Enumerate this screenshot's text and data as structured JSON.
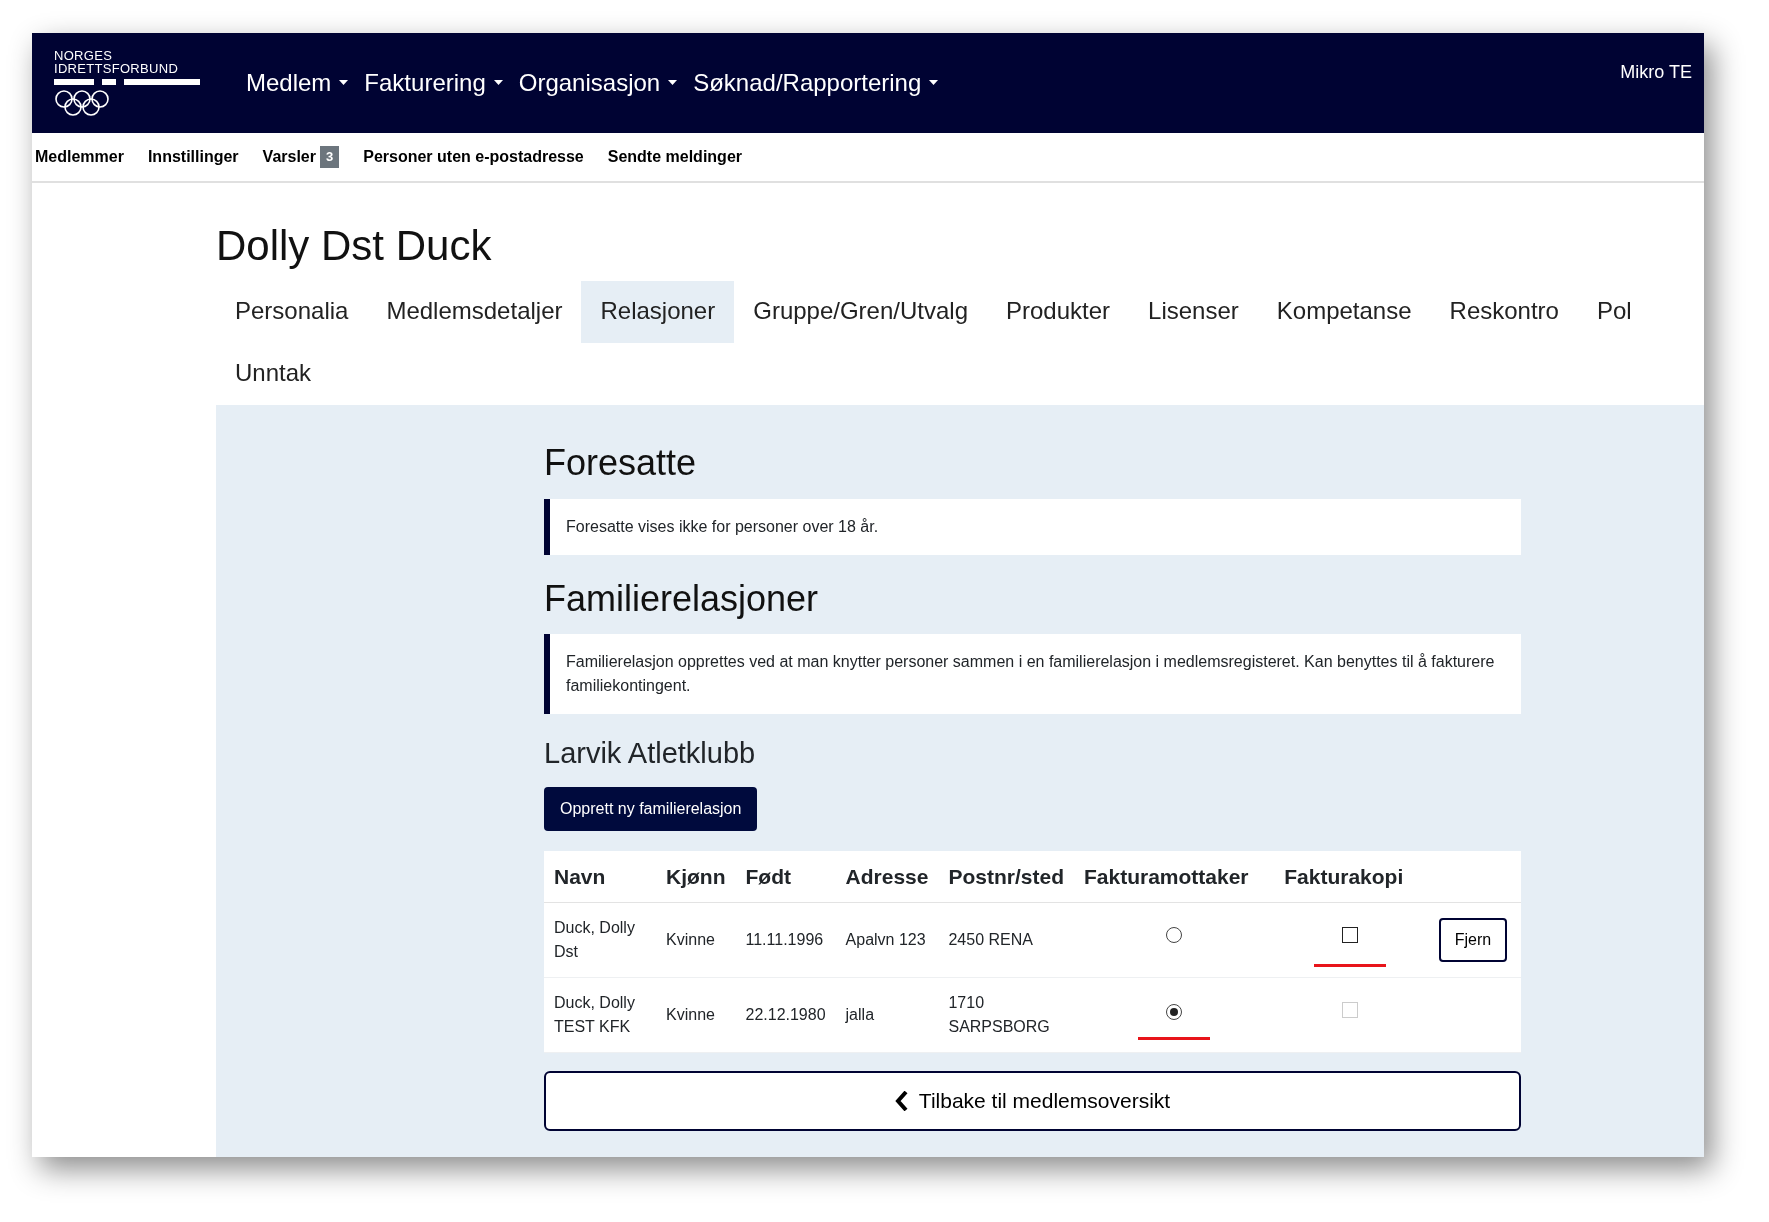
{
  "header": {
    "logo": {
      "line_1": "NORGES",
      "line_2": "IDRETTSFORBUND"
    },
    "menu": [
      {
        "label": "Medlem"
      },
      {
        "label": "Fakturering"
      },
      {
        "label": "Organisasjon"
      },
      {
        "label": "Søknad/Rapportering"
      }
    ],
    "user": "Mikro TE"
  },
  "subnav": [
    {
      "label": "Medlemmer"
    },
    {
      "label": "Innstillinger"
    },
    {
      "label": "Varsler",
      "badge": "3"
    },
    {
      "label": "Personer uten e-postadresse"
    },
    {
      "label": "Sendte meldinger"
    }
  ],
  "page_title": "Dolly Dst Duck",
  "tabs": [
    {
      "label": "Personalia",
      "selected": false
    },
    {
      "label": "Medlemsdetaljer",
      "selected": false
    },
    {
      "label": "Relasjoner",
      "selected": true
    },
    {
      "label": "Gruppe/Gren/Utvalg",
      "selected": false
    },
    {
      "label": "Produkter",
      "selected": false
    },
    {
      "label": "Lisenser",
      "selected": false
    },
    {
      "label": "Kompetanse",
      "selected": false
    },
    {
      "label": "Reskontro",
      "selected": false
    },
    {
      "label": "Pol",
      "selected": false
    },
    {
      "label": "Unntak",
      "selected": false
    }
  ],
  "sections": [
    {
      "heading": "Foresatte",
      "note": "Foresatte vises ikke for personer over 18 år."
    },
    {
      "heading": "Familierelasjoner",
      "note": "Familierelasjon opprettes ved at man knytter personer sammen i en familierelasjon i medlemsregisteret. Kan benyttes til å fakturere familiekontingent."
    }
  ],
  "club": {
    "name": "Larvik Atletklubb",
    "create_button": "Opprett ny familierelasjon"
  },
  "table": {
    "columns": [
      "Navn",
      "Kjønn",
      "Født",
      "Adresse",
      "Postnr/sted",
      "Fakturamottaker",
      "Fakturakopi"
    ],
    "rows": [
      {
        "navn": "Duck, Dolly Dst",
        "kjonn": "Kvinne",
        "fodt": "11.11.1996",
        "adresse": "Apalvn 123",
        "postnr": "2450 RENA",
        "mottaker": {
          "selected": false,
          "marked": false
        },
        "kopi": {
          "checked": false,
          "disabled": false,
          "marked": true
        },
        "remove_button": "Fjern"
      },
      {
        "navn": "Duck, Dolly TEST KFK",
        "kjonn": "Kvinne",
        "fodt": "22.12.1980",
        "adresse": "jalla",
        "postnr": "1710 SARPSBORG",
        "mottaker": {
          "selected": true,
          "marked": true
        },
        "kopi": {
          "checked": false,
          "disabled": true,
          "marked": false
        }
      }
    ]
  },
  "back_button": "Tilbake til medlemsoversikt"
}
